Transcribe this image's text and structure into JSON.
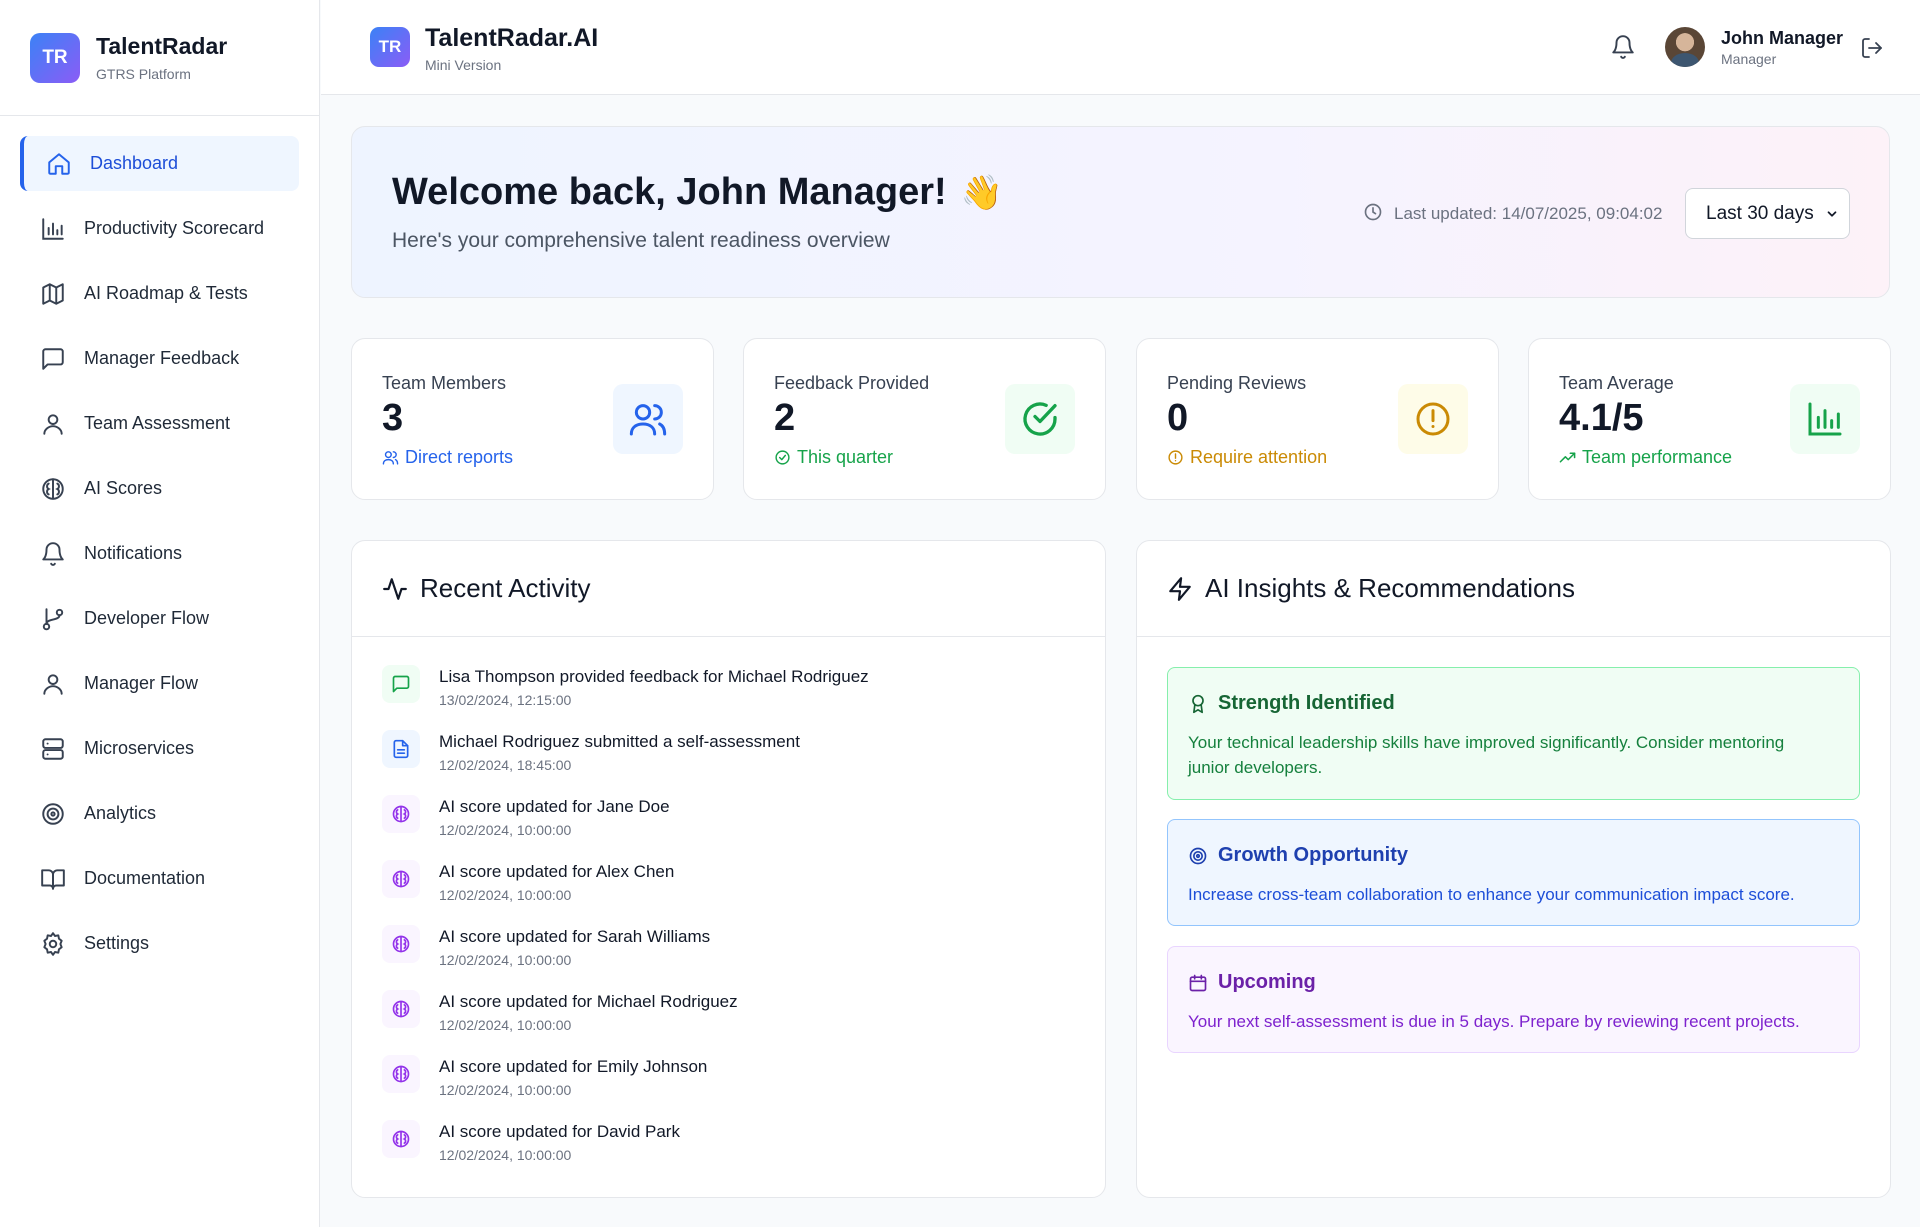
{
  "sidebar": {
    "brand_initials": "TR",
    "brand_title": "TalentRadar",
    "brand_subtitle": "GTRS Platform",
    "items": [
      {
        "label": "Dashboard",
        "icon": "home-icon",
        "active": true
      },
      {
        "label": "Productivity Scorecard",
        "icon": "bar-chart-icon"
      },
      {
        "label": "AI Roadmap & Tests",
        "icon": "map-icon"
      },
      {
        "label": "Manager Feedback",
        "icon": "message-square-icon"
      },
      {
        "label": "Team Assessment",
        "icon": "user-icon"
      },
      {
        "label": "AI Scores",
        "icon": "brain-icon"
      },
      {
        "label": "Notifications",
        "icon": "bell-icon"
      },
      {
        "label": "Developer Flow",
        "icon": "git-branch-icon"
      },
      {
        "label": "Manager Flow",
        "icon": "user-icon"
      },
      {
        "label": "Microservices",
        "icon": "server-icon"
      },
      {
        "label": "Analytics",
        "icon": "target-icon"
      },
      {
        "label": "Documentation",
        "icon": "book-open-icon"
      },
      {
        "label": "Settings",
        "icon": "gear-icon"
      }
    ]
  },
  "header": {
    "logo_initials": "TR",
    "title": "TalentRadar.AI",
    "subtitle": "Mini Version",
    "user_name": "John Manager",
    "user_role": "Manager"
  },
  "welcome": {
    "title": "Welcome back, John Manager!",
    "emoji": "👋",
    "subtitle": "Here's your comprehensive talent readiness overview",
    "last_updated": "Last updated: 14/07/2025, 09:04:02",
    "range_selected": "Last 30 days"
  },
  "stats": [
    {
      "label": "Team Members",
      "value": "3",
      "note": "Direct reports",
      "color": "#2563eb",
      "bg": "#eff6ff",
      "icon": "users-icon"
    },
    {
      "label": "Feedback Provided",
      "value": "2",
      "note": "This quarter",
      "color": "#16a34a",
      "bg": "#f0fdf4",
      "icon": "check-circle-icon"
    },
    {
      "label": "Pending Reviews",
      "value": "0",
      "note": "Require attention",
      "color": "#ca8a04",
      "bg": "#fefce8",
      "icon": "alert-circle-icon"
    },
    {
      "label": "Team Average",
      "value": "4.1/5",
      "note": "Team performance",
      "color": "#16a34a",
      "bg": "#f0fdf4",
      "icon": "bar-chart-icon"
    }
  ],
  "activity": {
    "title": "Recent Activity",
    "items": [
      {
        "text": "Lisa Thompson provided feedback for Michael Rodriguez",
        "time": "13/02/2024, 12:15:00",
        "type": "feedback"
      },
      {
        "text": "Michael Rodriguez submitted a self-assessment",
        "time": "12/02/2024, 18:45:00",
        "type": "assessment"
      },
      {
        "text": "AI score updated for Jane Doe",
        "time": "12/02/2024, 10:00:00",
        "type": "ai"
      },
      {
        "text": "AI score updated for Alex Chen",
        "time": "12/02/2024, 10:00:00",
        "type": "ai"
      },
      {
        "text": "AI score updated for Sarah Williams",
        "time": "12/02/2024, 10:00:00",
        "type": "ai"
      },
      {
        "text": "AI score updated for Michael Rodriguez",
        "time": "12/02/2024, 10:00:00",
        "type": "ai"
      },
      {
        "text": "AI score updated for Emily Johnson",
        "time": "12/02/2024, 10:00:00",
        "type": "ai"
      },
      {
        "text": "AI score updated for David Park",
        "time": "12/02/2024, 10:00:00",
        "type": "ai"
      }
    ]
  },
  "insights": {
    "title": "AI Insights & Recommendations",
    "items": [
      {
        "title": "Strength Identified",
        "body": "Your technical leadership skills have improved significantly. Consider mentoring junior developers.",
        "icon": "award-icon",
        "color": "#166534",
        "bg": "#f0fdf4",
        "border": "#86efac"
      },
      {
        "title": "Growth Opportunity",
        "body": "Increase cross-team collaboration to enhance your communication impact score.",
        "icon": "target-icon",
        "color": "#1e40af",
        "bg": "#eff6ff",
        "border": "#93c5fd"
      },
      {
        "title": "Upcoming",
        "body": "Your next self-assessment is due in 5 days. Prepare by reviewing recent projects.",
        "icon": "calendar-icon",
        "color": "#7e22ce",
        "bg": "#faf5ff",
        "border": "#e9d5ff"
      }
    ]
  }
}
